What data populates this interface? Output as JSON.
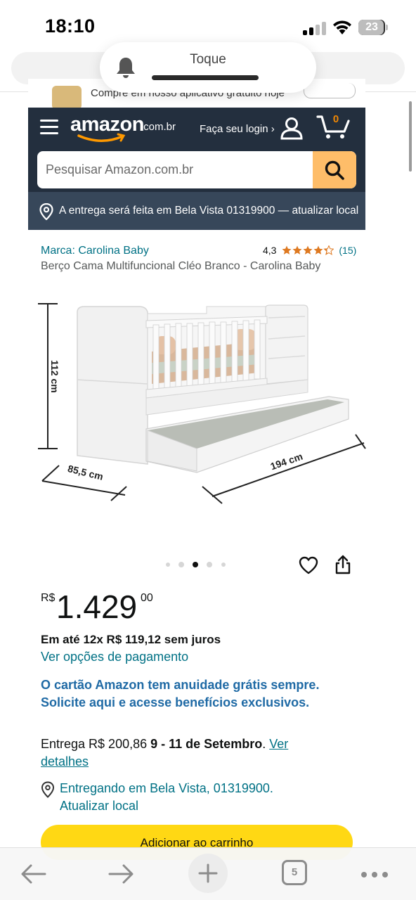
{
  "status_bar": {
    "time": "18:10",
    "battery": "23"
  },
  "notification": {
    "title": "Toque"
  },
  "app_banner": {
    "text": "Compre em nosso aplicativo gratuito hoje"
  },
  "header": {
    "logo_text": "amazon",
    "logo_tld": ".com.br",
    "login_label": "Faça seu login ›",
    "cart_count": "0",
    "search_placeholder": "Pesquisar Amazon.com.br",
    "delivery_text": "A entrega será feita em Bela Vista 01319900 — atualizar local"
  },
  "product": {
    "brand": "Marca: Carolina Baby",
    "rating_value": "4,3",
    "rating_count": "(15)",
    "rating_stars": 4.3,
    "title": "Berço Cama Multifuncional Cléo Branco - Carolina Baby",
    "image_labels": {
      "height": "112 cm",
      "depth": "85,5 cm",
      "length": "194 cm"
    },
    "carousel_total": 5,
    "carousel_active": 3
  },
  "price": {
    "symbol": "R$",
    "whole": "1.429",
    "fraction": "00",
    "installments": "Em até 12x R$ 119,12 sem juros",
    "payment_options": "Ver opções de pagamento",
    "card_promo": "O cartão Amazon tem anuidade grátis sempre. Solicite aqui e acesse benefícios exclusivos."
  },
  "delivery": {
    "prefix": "Entrega R$ 200,86 ",
    "dates": "9 - 11 de Setembro",
    "suffix": ". ",
    "details_link": "Ver detalhes",
    "location_line1": "Entregando em Bela Vista, 01319900.",
    "location_line2": "Atualizar local"
  },
  "buttons": {
    "add_to_cart": "Adicionar ao carrinho"
  },
  "toolbar": {
    "tabs_count": "5"
  },
  "colors": {
    "header_bg": "#232f3e",
    "delivery_bar_bg": "#37475a",
    "search_button": "#febd69",
    "link": "#007185",
    "promo_link": "#1f6aa5",
    "add_to_cart_bg": "#ffd814",
    "star": "#de7921"
  }
}
